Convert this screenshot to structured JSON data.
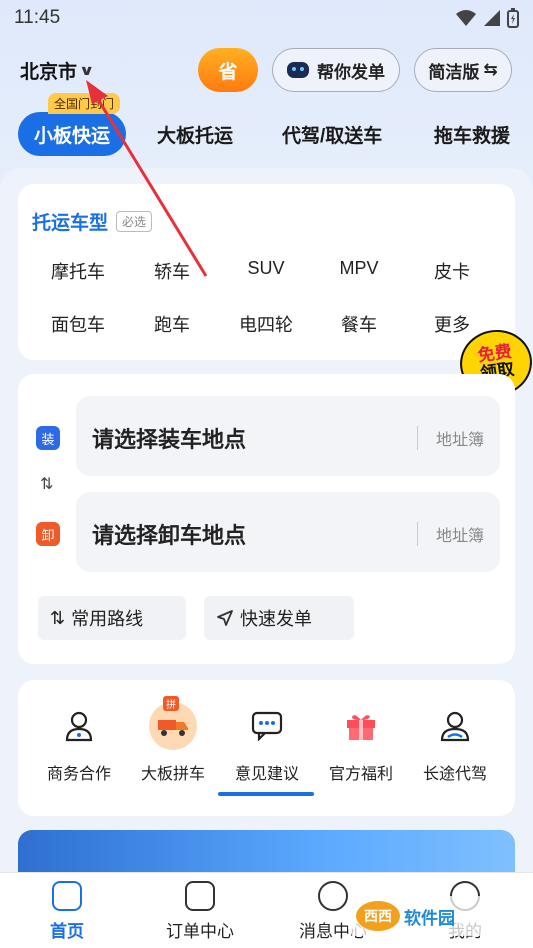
{
  "status_bar": {
    "time": "11:45"
  },
  "header": {
    "city": "北京市",
    "saver_label": "省",
    "help_label": "帮你发单",
    "simple_label": "简洁版"
  },
  "hot_tag": "全国门到门",
  "tabs": [
    {
      "label": "小板快运",
      "active": true
    },
    {
      "label": "大板托运"
    },
    {
      "label": "代驾/取送车"
    },
    {
      "label": "拖车救援"
    }
  ],
  "vehicle_types": {
    "title": "托运车型",
    "required": "必选",
    "row1": [
      "摩托车",
      "轿车",
      "SUV",
      "MPV",
      "皮卡"
    ],
    "row2": [
      "面包车",
      "跑车",
      "电四轮",
      "餐车",
      "更多"
    ]
  },
  "promo": {
    "line1": "免费",
    "line2": "领取"
  },
  "address": {
    "load_badge": "装",
    "load_placeholder": "请选择装车地点",
    "unload_badge": "卸",
    "unload_placeholder": "请选择卸车地点",
    "book_label": "地址簿",
    "common_route": "常用路线",
    "quick_order": "快速发单"
  },
  "services": [
    {
      "label": "商务合作",
      "icon": "person-icon"
    },
    {
      "label": "大板拼车",
      "icon": "truck-icon",
      "badge": "拼"
    },
    {
      "label": "意见建议",
      "icon": "chat-icon"
    },
    {
      "label": "官方福利",
      "icon": "gift-icon"
    },
    {
      "label": "长途代驾",
      "icon": "driver-icon"
    }
  ],
  "bottom_nav": [
    {
      "label": "首页",
      "active": true
    },
    {
      "label": "订单中心"
    },
    {
      "label": "消息中心"
    },
    {
      "label": "我的"
    }
  ],
  "watermark": {
    "logo": "西西",
    "text": "软件园"
  },
  "colors": {
    "accent": "#1a6fe6",
    "orange": "#ff7a10",
    "load_badge": "#2d6be6",
    "unload_badge": "#f05a28"
  }
}
